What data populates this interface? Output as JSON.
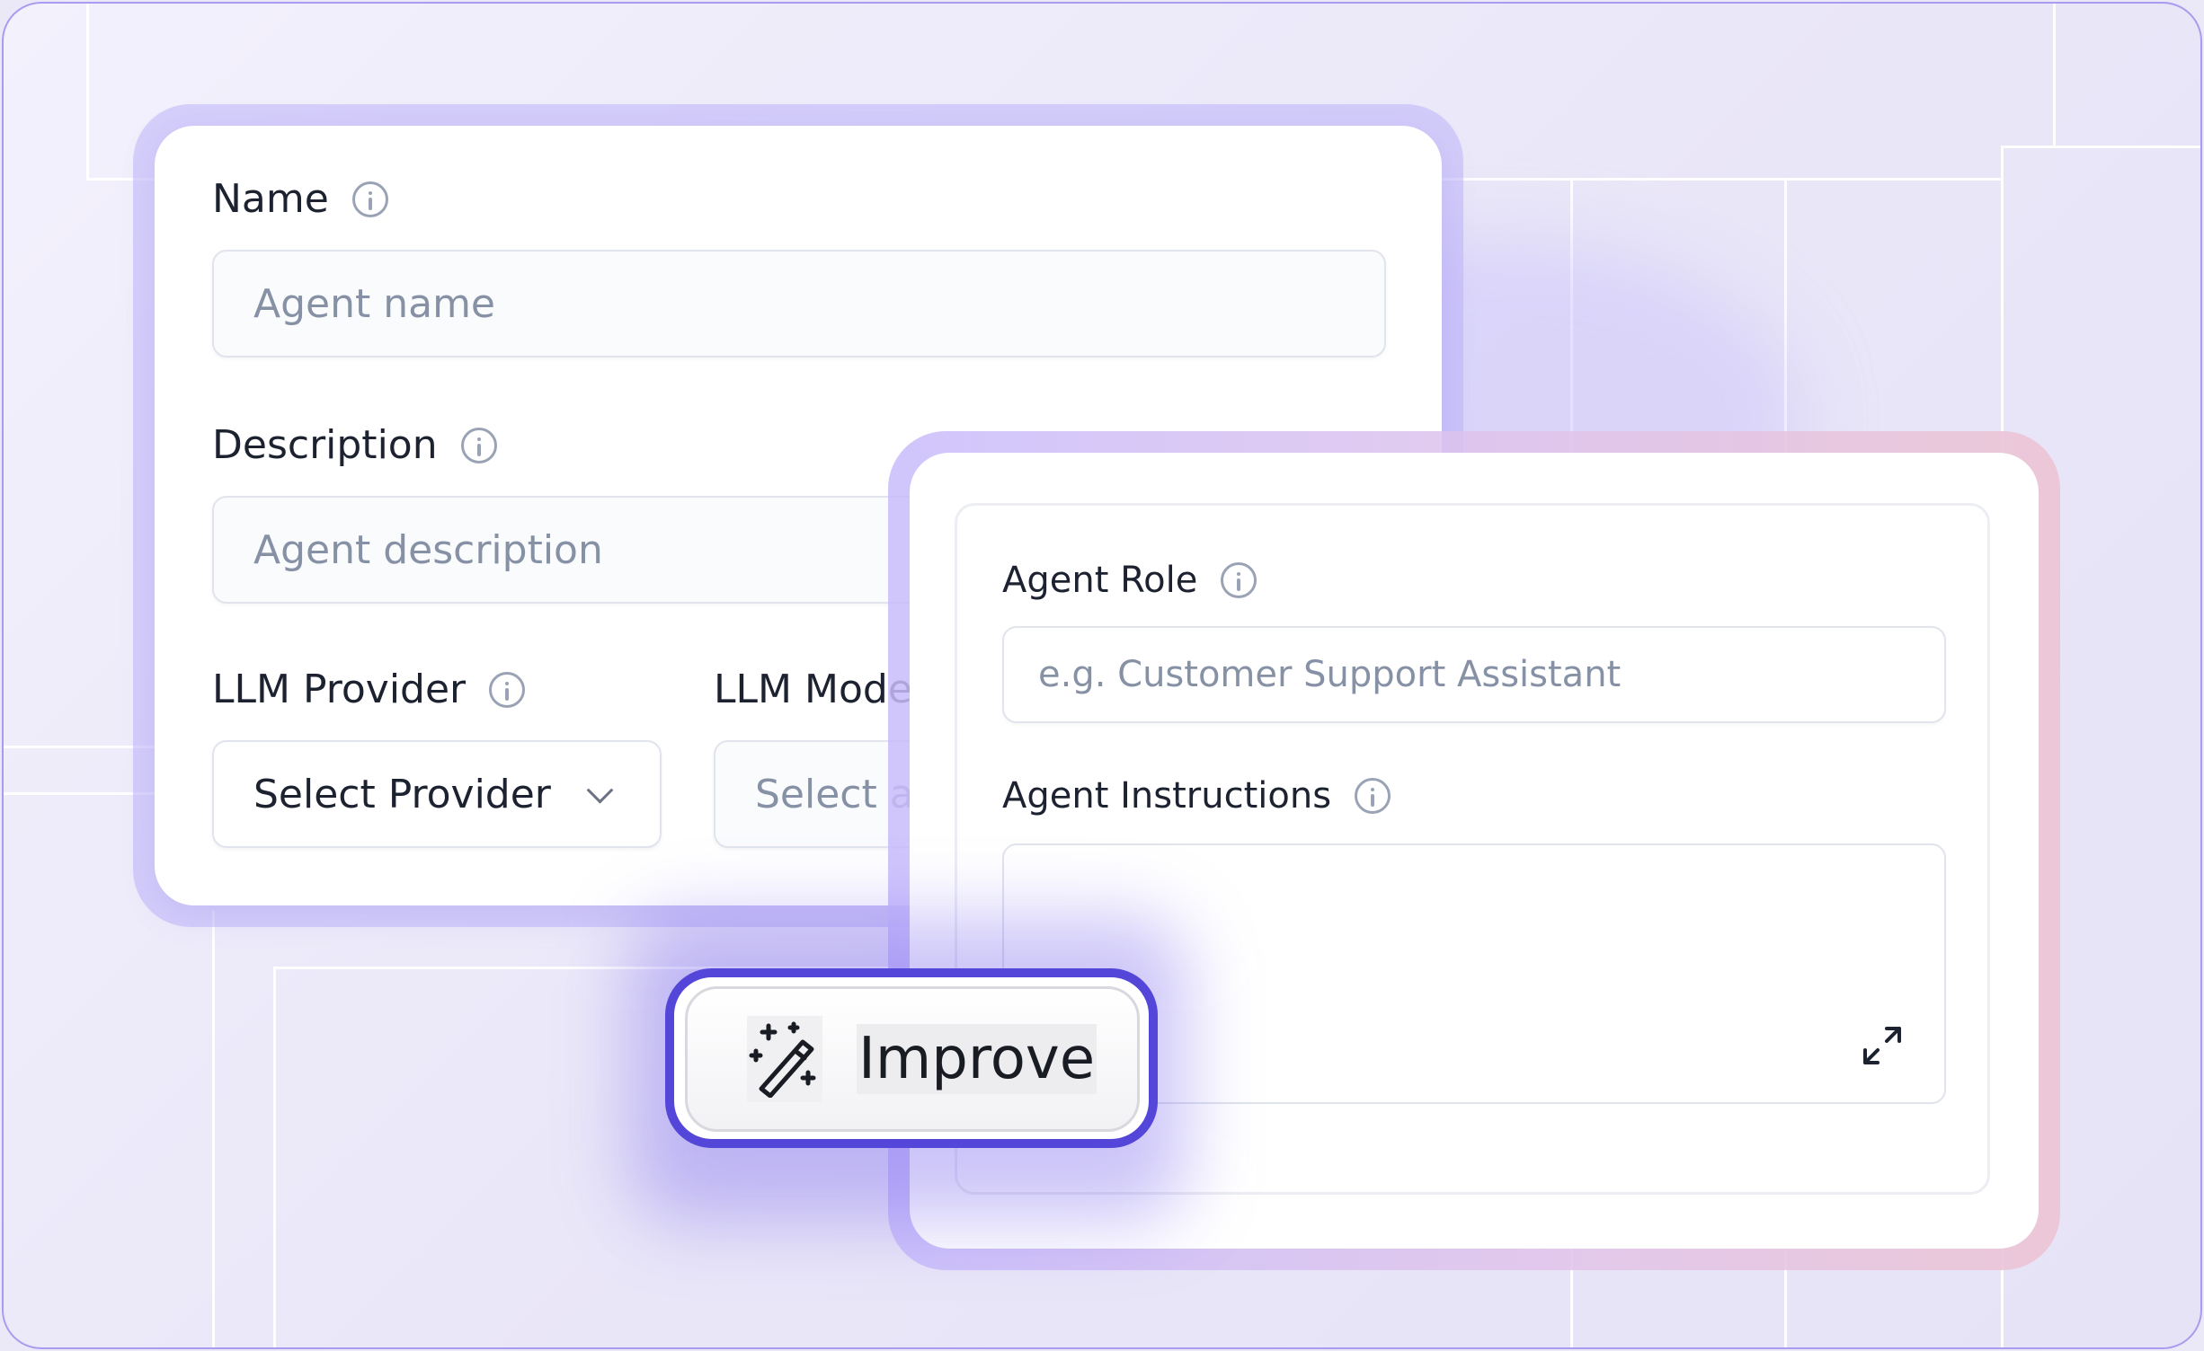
{
  "form_main": {
    "name": {
      "label": "Name",
      "placeholder": "Agent name"
    },
    "description": {
      "label": "Description",
      "placeholder": "Agent description"
    },
    "llm_provider": {
      "label": "LLM Provider",
      "selected": "Select Provider"
    },
    "llm_model": {
      "label": "LLM Mode",
      "selected": "Select a"
    }
  },
  "form_role": {
    "agent_role": {
      "label": "Agent Role",
      "placeholder": "e.g. Customer Support Assistant"
    },
    "agent_instructions": {
      "label": "Agent Instructions",
      "value": ""
    }
  },
  "improve_button": {
    "label": "Improve",
    "icon": "magic-wand-icon"
  },
  "colors": {
    "accent": "#5346d8",
    "frame_border": "#a89cf0",
    "card_shell": "#c3b9fa",
    "text_primary": "#1d2230",
    "placeholder": "#8791a6"
  }
}
